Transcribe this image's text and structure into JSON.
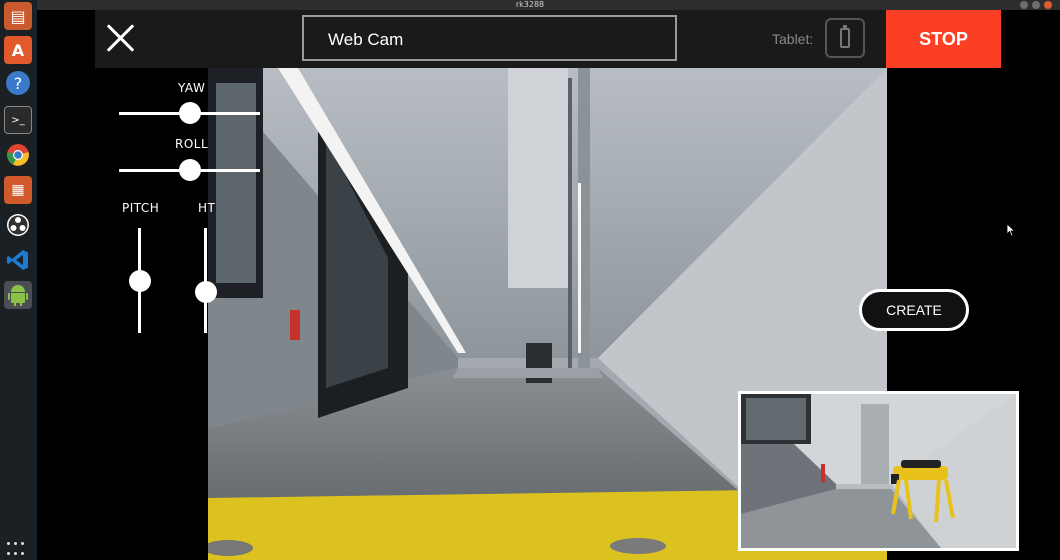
{
  "window": {
    "title": "rk3288"
  },
  "dock": {
    "items": [
      {
        "name": "files",
        "glyph": "▤",
        "color": "#c95a2e"
      },
      {
        "name": "software",
        "glyph": "A",
        "color": "#e2592b"
      },
      {
        "name": "help",
        "glyph": "?",
        "color": "#3b79c9"
      },
      {
        "name": "terminal",
        "glyph": ">_",
        "color": "#2b2b2b"
      },
      {
        "name": "chrome",
        "glyph": "◉",
        "color": "#e0452f"
      },
      {
        "name": "impress",
        "glyph": "▦",
        "color": "#d05a2b"
      },
      {
        "name": "obs",
        "glyph": "◎",
        "color": "#333"
      },
      {
        "name": "vscode",
        "glyph": "❮❯",
        "color": "#1f7bd1"
      },
      {
        "name": "android-studio",
        "glyph": "◈",
        "color": "#8bc34a"
      }
    ]
  },
  "topbar": {
    "camera_select": "Web Cam",
    "tablet_label": "Tablet:",
    "stop_label": "STOP"
  },
  "sliders": {
    "yaw_label": "YAW",
    "roll_label": "ROLL",
    "pitch_label": "PITCH",
    "height_label": "HT"
  },
  "create_label": "CREATE",
  "colors": {
    "stop": "#fa3f24",
    "topbar": "#1a1a1a",
    "robot": "#e8c21a"
  }
}
